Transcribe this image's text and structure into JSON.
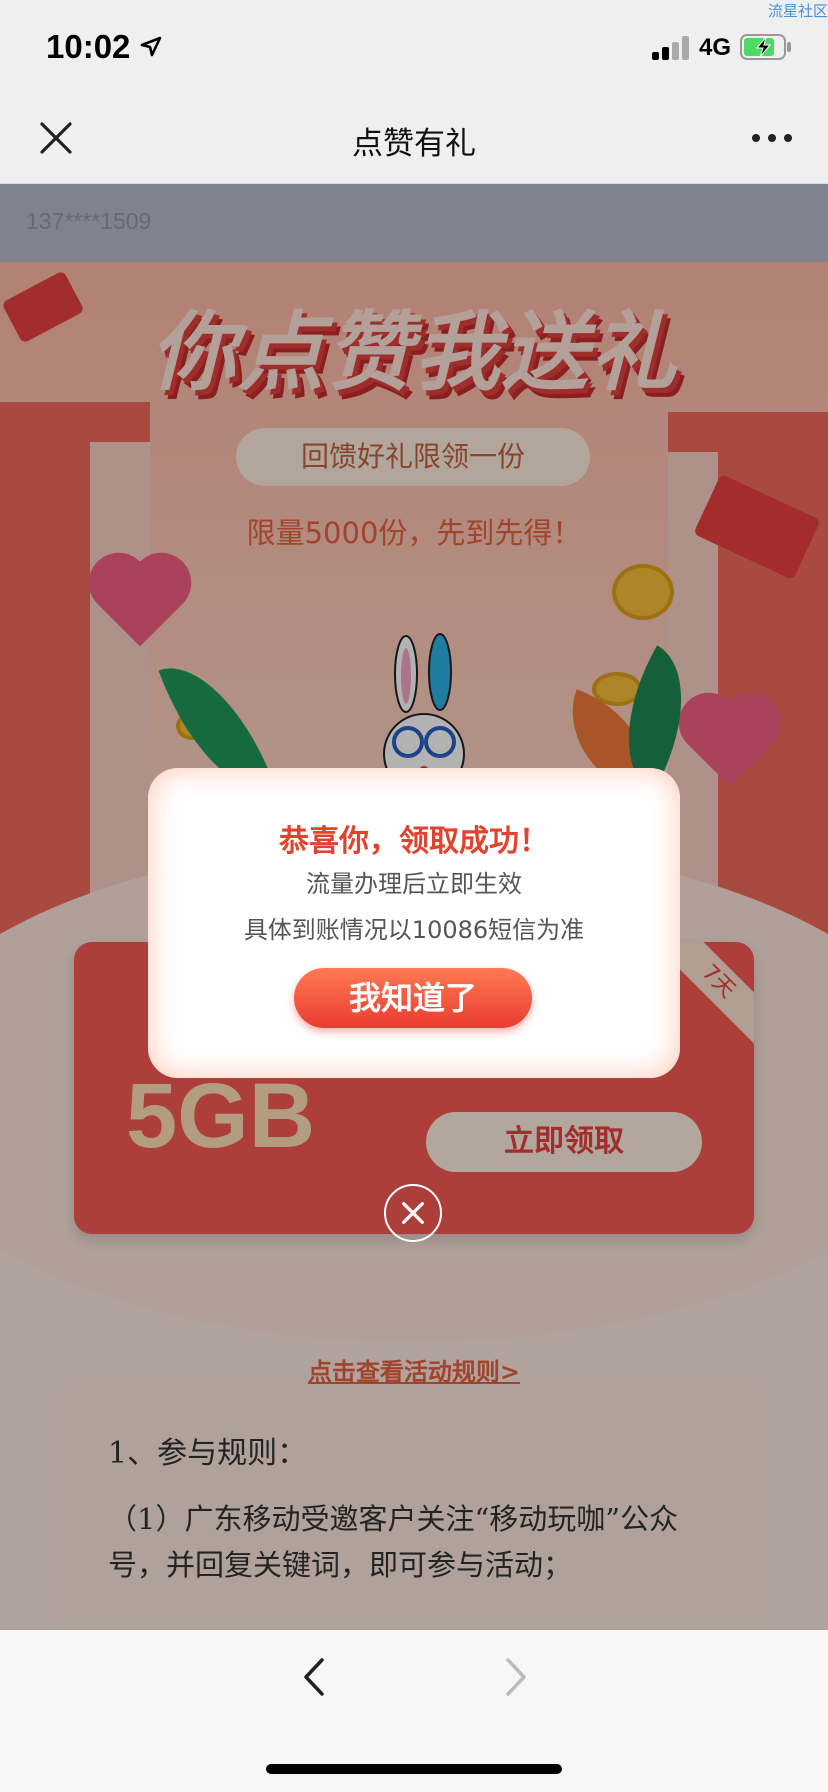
{
  "status_bar": {
    "watermark": "流星社区",
    "time": "10:02",
    "network": "4G",
    "location_icon": "location-arrow-icon",
    "signal_icon": "cellular-signal-icon",
    "battery_icon": "battery-charging-icon"
  },
  "nav": {
    "title": "点赞有礼",
    "close_icon": "close-icon",
    "more_icon": "more-icon"
  },
  "page": {
    "phone": "137****1509",
    "banner_title": "你点赞我送礼",
    "gift_pill": "回馈好礼限领一份",
    "limit_text": "限量5000份，先到先得！",
    "card": {
      "tag": "7天",
      "data_amount": "5GB",
      "claim_button": "立即领取"
    },
    "rules_link": "点击查看活动规则>",
    "rules": {
      "heading": "1、参与规则：",
      "paragraph": "（1）广东移动受邀客户关注“移动玩咖”公众号，并回复关键词，即可参与活动；"
    }
  },
  "dialog": {
    "title": "恭喜你，领取成功！",
    "line1": "流量办理后立即生效",
    "line2": "具体到账情况以10086短信为准",
    "button": "我知道了",
    "close_icon": "circle-close-icon"
  },
  "toolbar": {
    "back_icon": "chevron-left-icon",
    "forward_icon": "chevron-right-icon"
  },
  "colors": {
    "accent_red": "#e8413f",
    "dialog_title": "#e2432f",
    "link_blue": "#4a90d9"
  }
}
